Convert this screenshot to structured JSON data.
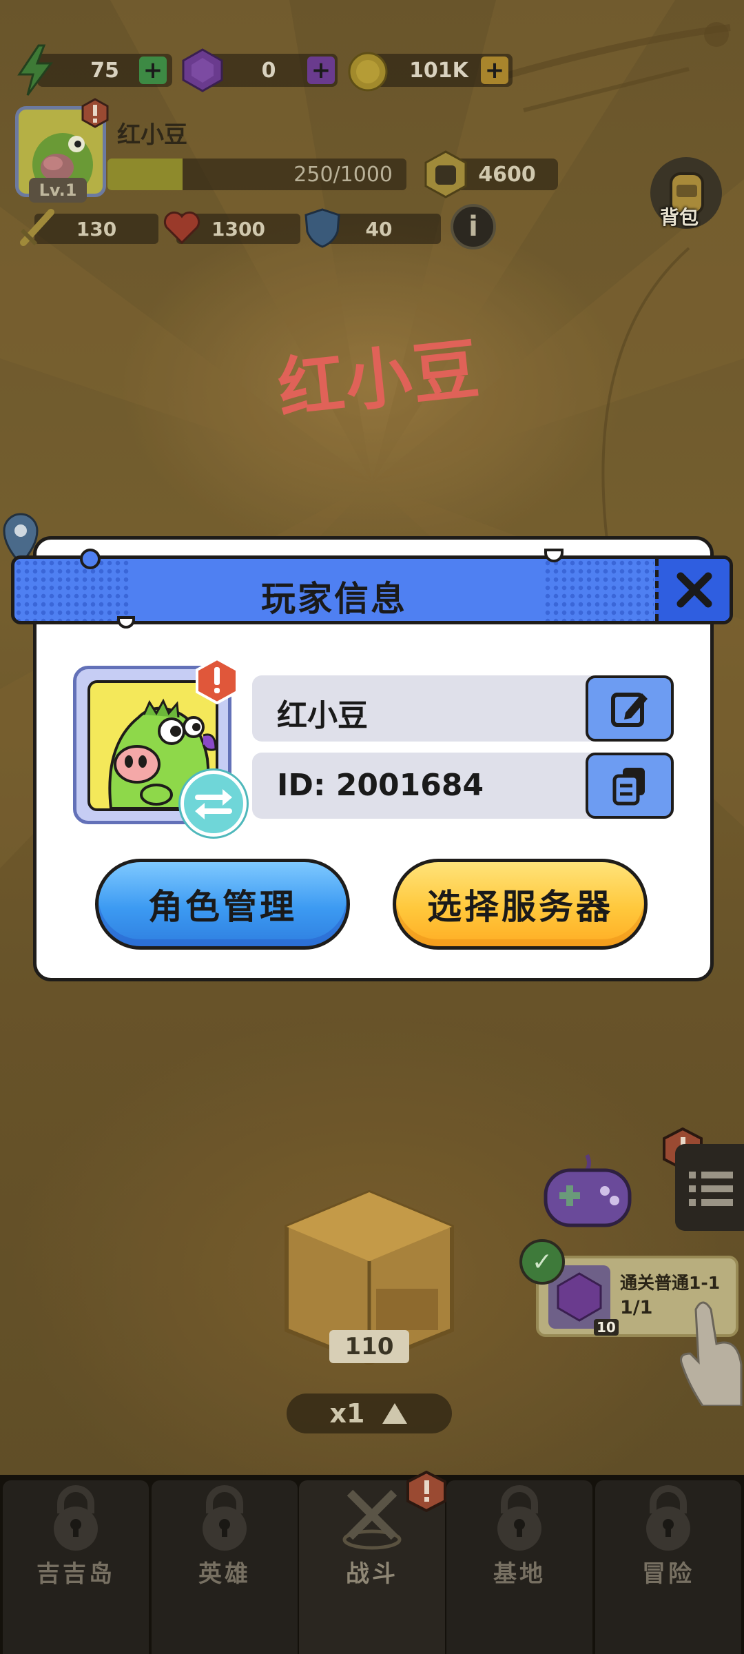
{
  "hud": {
    "energy": "75",
    "gems": "0",
    "coins": "101K",
    "player_name": "红小豆",
    "level": "Lv.1",
    "xp": "250/1000",
    "xp_progress": 0.25,
    "power": "4600",
    "attack": "130",
    "hp": "1300",
    "defense": "40",
    "bag_label": "背包"
  },
  "banner_name": "红小豆",
  "modal": {
    "title": "玩家信息",
    "name_value": "红小豆",
    "id_value": "ID: 2001684",
    "role_button": "角色管理",
    "server_button": "选择服务器"
  },
  "game": {
    "chest_count": "110",
    "speed": "x1",
    "quest_title": "通关普通1-1",
    "quest_progress": "1/1",
    "quest_reward_count": "10"
  },
  "nav": {
    "tabs": [
      {
        "label": "吉吉岛",
        "locked": true
      },
      {
        "label": "英雄",
        "locked": true
      },
      {
        "label": "战斗",
        "locked": false,
        "active": true
      },
      {
        "label": "基地",
        "locked": true
      },
      {
        "label": "冒险",
        "locked": true
      }
    ]
  },
  "icons": {
    "energy": "lightning-icon",
    "gems": "gem-icon",
    "coins": "coin-icon",
    "power": "fist-icon",
    "attack": "sword-icon",
    "hp": "heart-icon",
    "defense": "shield-icon",
    "info": "info-icon",
    "close": "close-icon",
    "edit": "edit-icon",
    "copy": "copy-icon",
    "swap": "swap-icon",
    "lock": "lock-icon",
    "battle": "crossed-swords-icon"
  },
  "colors": {
    "header_blue": "#4f80f2",
    "role_button": "#3c9af2",
    "server_button": "#ffc83c",
    "banner_name": "#e06258",
    "alert": "#e0573a"
  }
}
